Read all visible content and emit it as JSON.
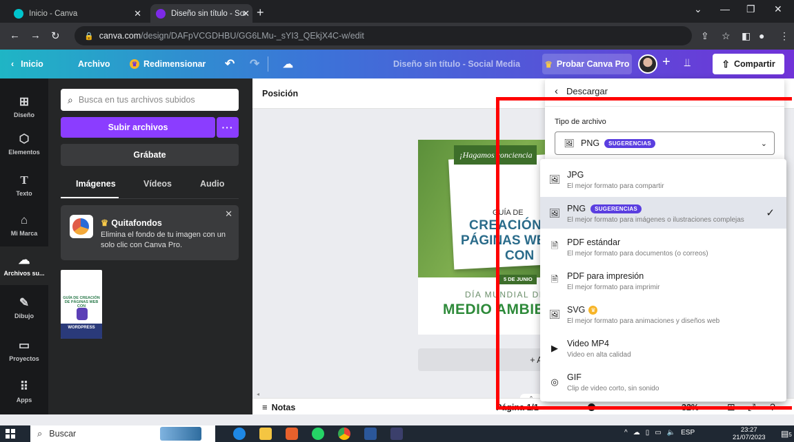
{
  "browser": {
    "tabs": [
      {
        "title": "Inicio - Canva",
        "favicon_color": "#00c4cc",
        "active": false
      },
      {
        "title": "Diseño sin título - Social Media",
        "favicon_color": "#7d2ae8",
        "active": true
      }
    ],
    "url_domain": "canva.com",
    "url_path": "/design/DAFpVCGDHBU/GG6LMu-_sYI3_QEkjX4C-w/edit"
  },
  "topbar": {
    "home": "Inicio",
    "file": "Archivo",
    "resize": "Redimensionar",
    "design_title": "Diseño sin título - Social Media",
    "try_pro": "Probar Canva Pro",
    "share": "Compartir",
    "gradient_start": "#1fb5c5",
    "gradient_end": "#7032d8"
  },
  "rail": {
    "items": [
      {
        "label": "Diseño",
        "icon": "layout-icon"
      },
      {
        "label": "Elementos",
        "icon": "shapes-icon"
      },
      {
        "label": "Texto",
        "icon": "text-icon"
      },
      {
        "label": "Mi Marca",
        "icon": "brand-icon"
      },
      {
        "label": "Archivos su...",
        "icon": "cloud-upload-icon"
      },
      {
        "label": "Dibujo",
        "icon": "draw-icon"
      },
      {
        "label": "Proyectos",
        "icon": "folder-icon"
      },
      {
        "label": "Apps",
        "icon": "apps-grid-icon"
      }
    ]
  },
  "panel": {
    "search_placeholder": "Busca en tus archivos subidos",
    "upload_button": "Subir archivos",
    "upload_more": "···",
    "record_button": "Grábate",
    "tabs": [
      "Imágenes",
      "Vídeos",
      "Audio"
    ],
    "promo": {
      "title": "Quitafondos",
      "description": "Elimina el fondo de tu imagen con un solo clic con Canva Pro."
    },
    "thumbnail": {
      "line1": "GUÍA DE CREACIÓN DE PÁGINAS WEB CON",
      "line2": "WORDPRESS"
    }
  },
  "editor": {
    "position_label": "Posición",
    "add_page": "+ Agregar página",
    "notes": "Notas",
    "page_info": "Página 1/1",
    "zoom": "32%",
    "zoom_fraction": 0.32,
    "design": {
      "banner": "¡Hagamos conciencia",
      "guia": "GUÍA DE",
      "creacion": "CREACIÓN DE",
      "paginas": "PÁGINAS WEB",
      "con": "CON",
      "date": "5 DE JUNIO",
      "dia": "DÍA MUNDIAL DEL",
      "medio": "MEDIO AMBIENTE"
    }
  },
  "download": {
    "title": "Descargar",
    "file_type_label": "Tipo de archivo",
    "selected_format": "PNG",
    "selected_badge": "SUGERENCIAS",
    "options": [
      {
        "name": "JPG",
        "desc": "El mejor formato para compartir",
        "icon": "image-icon"
      },
      {
        "name": "PNG",
        "badge": "SUGERENCIAS",
        "desc": "El mejor formato para imágenes o ilustraciones complejas",
        "icon": "image-icon",
        "selected": true
      },
      {
        "name": "PDF estándar",
        "desc": "El mejor formato para documentos (o correos)",
        "icon": "document-icon"
      },
      {
        "name": "PDF para impresión",
        "desc": "El mejor formato para imprimir",
        "icon": "document-icon"
      },
      {
        "name": "SVG",
        "pro": true,
        "desc": "El mejor formato para animaciones y diseños web",
        "icon": "image-icon"
      },
      {
        "name": "Video MP4",
        "desc": "Video en alta calidad",
        "icon": "video-icon"
      },
      {
        "name": "GIF",
        "desc": "Clip de video corto, sin sonido",
        "icon": "gif-icon"
      }
    ],
    "highlight_color": "#ff0000",
    "badge_color": "#5a3ee0"
  },
  "taskbar": {
    "search": "Buscar",
    "language": "ESP",
    "time": "23:27",
    "date": "21/07/2023",
    "notifications": "5"
  }
}
